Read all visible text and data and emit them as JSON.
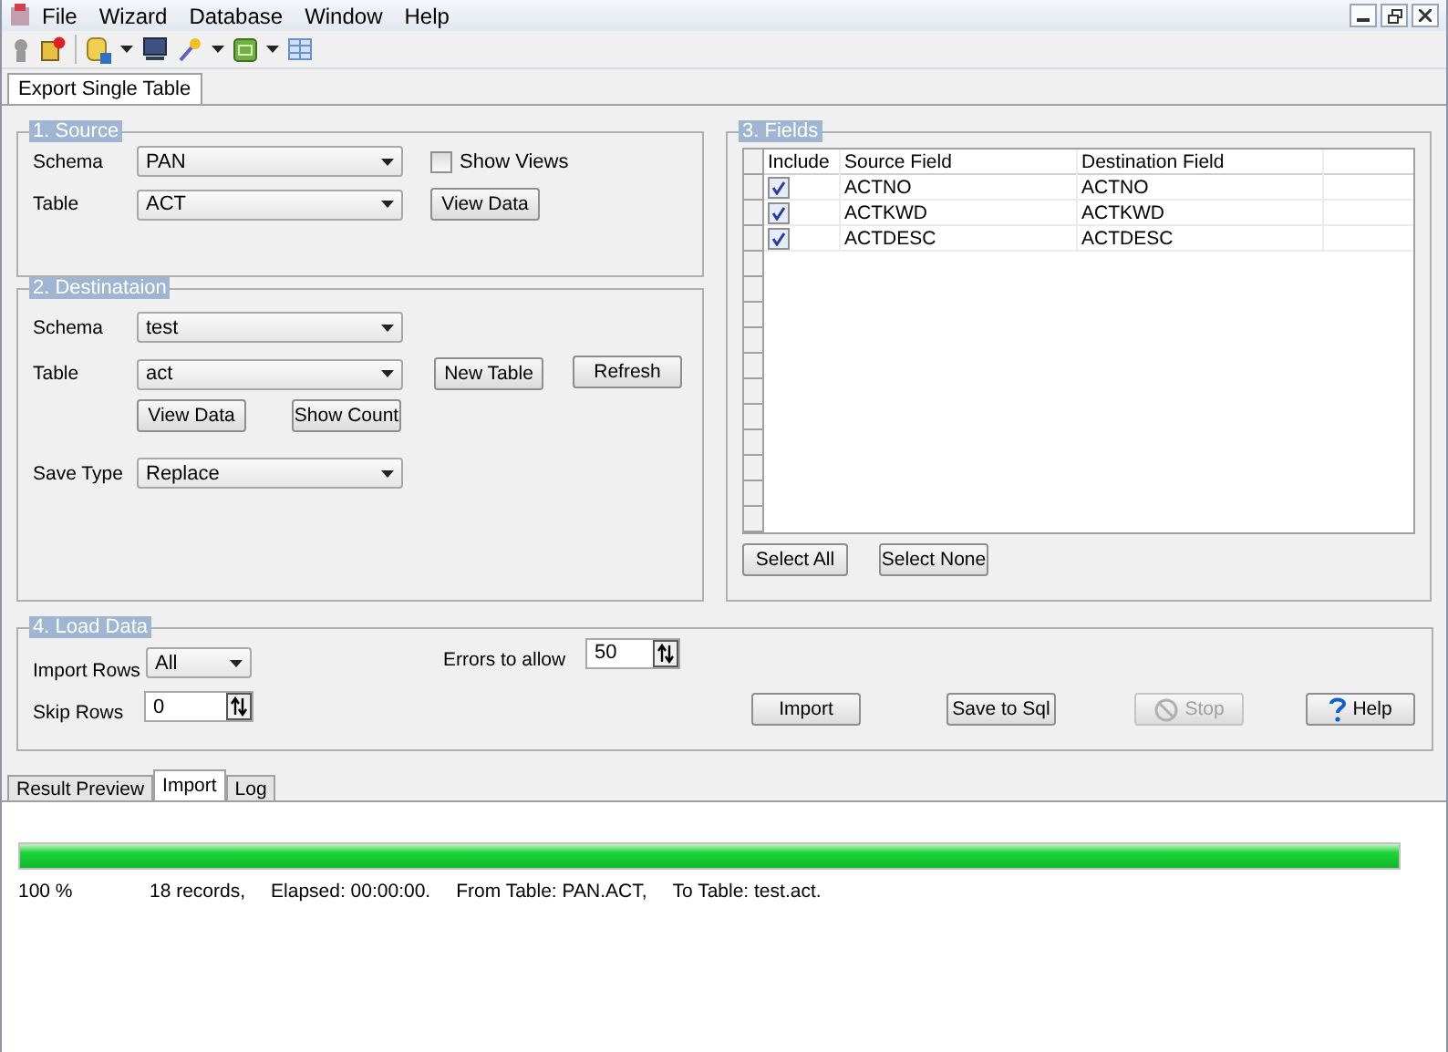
{
  "menu": [
    "File",
    "Wizard",
    "Database",
    "Window",
    "Help"
  ],
  "document_tab": {
    "label": "Export Single Table",
    "selected": true
  },
  "source": {
    "title": "1. Source",
    "schema_label": "Schema",
    "schema": "PAN",
    "table_label": "Table",
    "table": "ACT",
    "show_views": {
      "label": "Show Views",
      "checked": false
    },
    "view_data": "View Data"
  },
  "destination": {
    "title": "2. Destinataion",
    "schema_label": "Schema",
    "schema": "test",
    "table_label": "Table",
    "table": "act",
    "new_table": "New Table",
    "refresh": "Refresh",
    "view_data": "View Data",
    "show_count": "Show Count",
    "save_type_label": "Save Type",
    "save_type": "Replace"
  },
  "fields": {
    "title": "3. Fields",
    "columns": [
      "Include",
      "Source Field",
      "Destination Field"
    ],
    "rows": [
      {
        "include": true,
        "source": "ACTNO",
        "destination": "ACTNO"
      },
      {
        "include": true,
        "source": "ACTKWD",
        "destination": "ACTKWD"
      },
      {
        "include": true,
        "source": "ACTDESC",
        "destination": "ACTDESC"
      }
    ],
    "select_all": "Select All",
    "select_none": "Select None"
  },
  "load": {
    "title": "4. Load Data",
    "import_rows_label": "Import Rows",
    "import_rows": "All",
    "skip_rows_label": "Skip Rows",
    "skip_rows": "0",
    "errors_label": "Errors to allow",
    "errors": "50",
    "buttons": [
      {
        "kind": "plain",
        "label": "Import",
        "disabled": false
      },
      {
        "kind": "plain",
        "label": "Save to Sql",
        "disabled": false
      },
      {
        "kind": "stop",
        "label": "Stop",
        "disabled": true
      },
      {
        "kind": "help",
        "label": "Help",
        "disabled": false
      }
    ]
  },
  "bottom_tabs": [
    {
      "label": "Result Preview",
      "selected": false
    },
    {
      "label": "Import",
      "selected": true
    },
    {
      "label": "Log",
      "selected": false
    }
  ],
  "progress": {
    "level": 1,
    "percent": "100 %",
    "status": [
      "18 records,",
      "Elapsed: 00:00:00.",
      "From Table: PAN.ACT,",
      "To Table: test.act."
    ]
  }
}
